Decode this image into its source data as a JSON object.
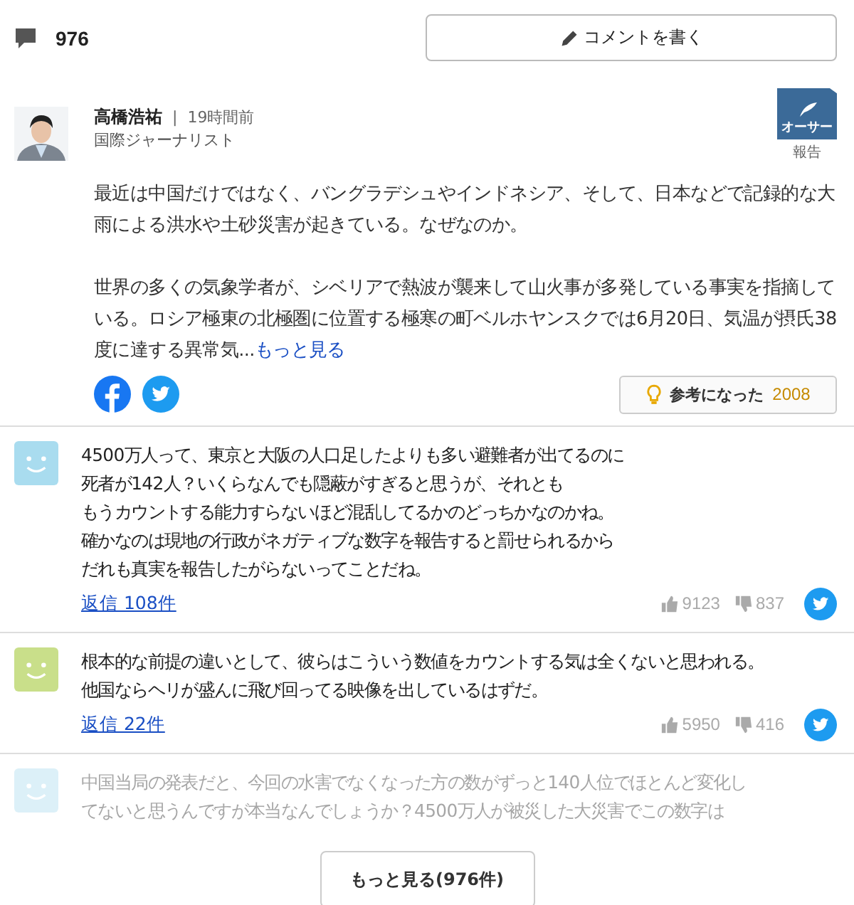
{
  "header": {
    "comment_count": "976",
    "write_button": "コメントを書く"
  },
  "author_comment": {
    "name": "高橋浩祐",
    "separator": "|",
    "time": "19時間前",
    "title": "国際ジャーナリスト",
    "badge": "オーサー",
    "report": "報告",
    "paragraphs": [
      "最近は中国だけではなく、バングラデシュやインドネシア、そして、日本などで記録的な大雨による洪水や土砂災害が起きている。なぜなのか。",
      "世界の多くの気象学者が、シベリアで熱波が襲来して山火事が多発している事実を指摘している。ロシア極東の北極圏に位置する極寒の町ベルホヤンスクでは6月20日、気温が摂氏38度に達する異常気..."
    ],
    "more_link": "もっと見る",
    "helpful_label": "参考になった",
    "helpful_count": "2008"
  },
  "comments": [
    {
      "color": "#a9dcef",
      "faded": false,
      "lines": [
        "4500万人って、東京と大阪の人口足したよりも多い避難者が出てるのに",
        "死者が142人？いくらなんでも隠蔽がすぎると思うが、それとも",
        "もうカウントする能力すらないほど混乱してるかのどっちかなのかね。",
        "確かなのは現地の行政がネガティブな数字を報告すると罰せられるから",
        "だれも真実を報告したがらないってことだね。"
      ],
      "replies": "返信 108件",
      "likes": "9123",
      "dislikes": "837"
    },
    {
      "color": "#c9df8a",
      "faded": false,
      "lines": [
        "根本的な前提の違いとして、彼らはこういう数値をカウントする気は全くないと思われる。",
        "他国ならヘリが盛んに飛び回ってる映像を出しているはずだ。"
      ],
      "replies": "返信 22件",
      "likes": "5950",
      "dislikes": "416"
    },
    {
      "color": "#dcf0f8",
      "faded": true,
      "lines": [
        "中国当局の発表だと、今回の水害でなくなった方の数がずっと140人位でほとんど変化し",
        "てないと思うんですが本当なんでしょうか？4500万人が被災した大災害でこの数字は"
      ]
    }
  ],
  "more_button": "もっと見る(976件)"
}
